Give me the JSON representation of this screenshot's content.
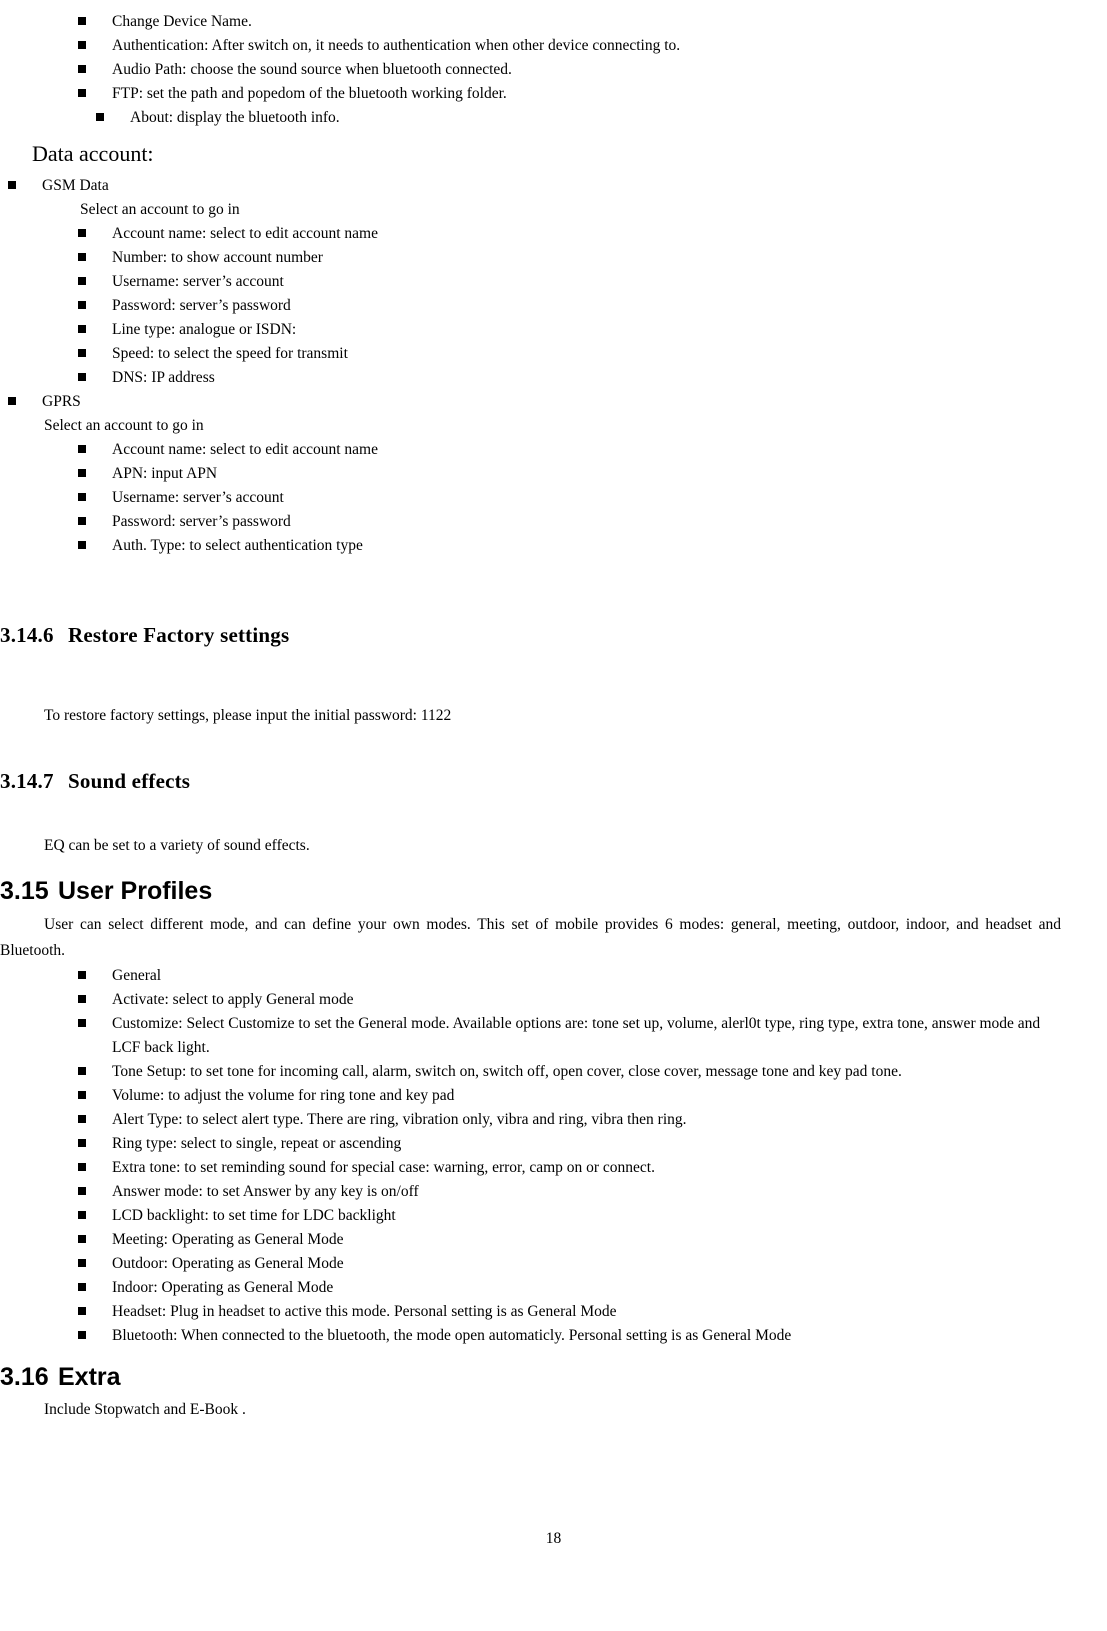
{
  "page": {
    "number": "18"
  },
  "bluetooth_items": [
    {
      "text": "Change Device Name."
    },
    {
      "text": "Authentication: After switch on, it needs to authentication when other device connecting to."
    },
    {
      "text": "Audio Path: choose the sound source when bluetooth connected."
    },
    {
      "text": "FTP: set the path and popedom of the bluetooth working folder."
    },
    {
      "text": "About: display the bluetooth info."
    }
  ],
  "data_account": {
    "heading": "Data account:",
    "gsm": {
      "label": "GSM Data",
      "intro": "Select an account to go in",
      "items": [
        {
          "text": "Account name: select to edit account name"
        },
        {
          "text": "Number: to show account number"
        },
        {
          "text": "Username: server’s account"
        },
        {
          "text": "Password: server’s password"
        },
        {
          "text": "Line type: analogue or ISDN:"
        },
        {
          "text": "Speed: to select the speed for transmit"
        },
        {
          "text": "DNS: IP address"
        }
      ]
    },
    "gprs": {
      "label": "GPRS",
      "intro": "Select an account to go in",
      "items": [
        {
          "text": "Account name: select to edit account name"
        },
        {
          "text": "APN: input APN"
        },
        {
          "text": "Username: server’s account"
        },
        {
          "text": "Password: server’s password"
        },
        {
          "text": "Auth. Type: to select authentication type"
        }
      ]
    }
  },
  "sections": {
    "restore_factory": {
      "number": "3.14.6",
      "title": "Restore Factory settings",
      "body": "To restore factory settings, please input the initial password: 1122"
    },
    "sound_effects": {
      "number": "3.14.7",
      "title": "Sound effects",
      "body": "EQ can be set to a variety of sound effects."
    },
    "user_profiles": {
      "number": "3.15",
      "title": "User Profiles",
      "intro": "User can select different mode, and can define your own modes. This set of mobile provides 6 modes: general, meeting, outdoor, indoor, and headset and Bluetooth.",
      "items": [
        {
          "text": "General"
        },
        {
          "text": "Activate: select to apply General mode"
        },
        {
          "text": "Customize: Select Customize to set the General mode. Available options are: tone set up, volume, alerl0t type, ring type, extra tone, answer mode and LCF back light."
        },
        {
          "text": "Tone Setup: to set tone for incoming call, alarm, switch on, switch off, open cover, close cover, message tone and key pad tone."
        },
        {
          "text": "Volume: to adjust the volume for ring tone and key pad"
        },
        {
          "text": "Alert Type: to select alert type. There are ring, vibration only, vibra and ring, vibra then ring."
        },
        {
          "text": "Ring type: select to single, repeat or ascending"
        },
        {
          "text": "Extra tone: to set reminding sound for special case: warning, error, camp on or connect."
        },
        {
          "text": "Answer mode: to set Answer by any key is on/off"
        },
        {
          "text": "LCD backlight: to set time for LDC backlight"
        },
        {
          "text": "Meeting: Operating as General Mode"
        },
        {
          "text": "Outdoor: Operating as General Mode"
        },
        {
          "text": "Indoor: Operating as General Mode"
        },
        {
          "text": "Headset: Plug in headset to active this mode. Personal setting is as General Mode"
        },
        {
          "text": "Bluetooth: When connected to the bluetooth, the mode open automaticly. Personal setting is as General Mode"
        }
      ]
    },
    "extra": {
      "number": "3.16",
      "title": "Extra",
      "body": "Include Stopwatch and E-Book ."
    }
  }
}
